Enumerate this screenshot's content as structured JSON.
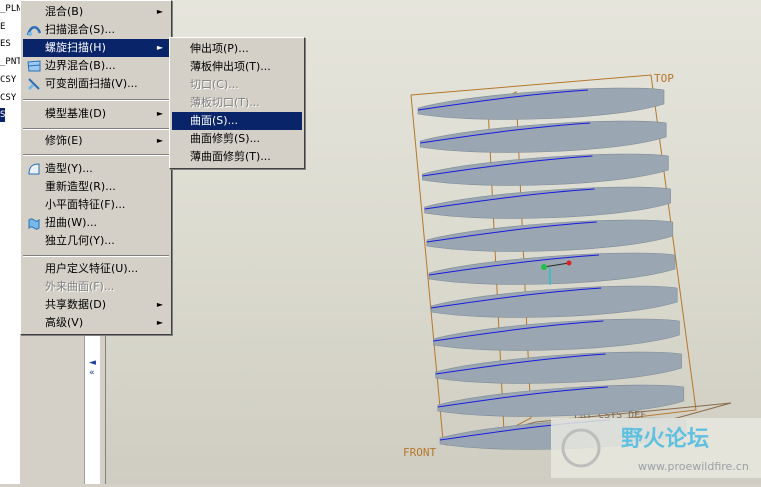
{
  "tree": {
    "items": [
      {
        "text": "_PLN",
        "selected": false
      },
      {
        "text": "E",
        "selected": false
      },
      {
        "text": "ES",
        "selected": false
      },
      {
        "text": "_PNT",
        "selected": false
      },
      {
        "text": "CSY",
        "selected": false
      },
      {
        "text": "CSY",
        "selected": false
      },
      {
        "text": "S",
        "selected": true
      }
    ]
  },
  "menu": {
    "items": [
      {
        "label": "混合(B)",
        "submenu": true,
        "icon": "none"
      },
      {
        "label": "扫描混合(S)...",
        "icon": "sweep-blend-icon"
      },
      {
        "label": "螺旋扫描(H)",
        "submenu": true,
        "highlighted": true,
        "icon": "none"
      },
      {
        "label": "边界混合(B)...",
        "icon": "boundary-blend-icon"
      },
      {
        "label": "可变剖面扫描(V)...",
        "icon": "variable-section-sweep-icon"
      },
      {
        "label": "模型基准(D)",
        "submenu": true,
        "icon": "none"
      },
      {
        "label": "修饰(E)",
        "submenu": true,
        "icon": "none"
      },
      {
        "label": "造型(Y)...",
        "icon": "style-icon"
      },
      {
        "label": "重新造型(R)...",
        "icon": "none"
      },
      {
        "label": "小平面特征(F)...",
        "icon": "none"
      },
      {
        "label": "扭曲(W)...",
        "icon": "warp-icon"
      },
      {
        "label": "独立几何(Y)...",
        "icon": "none"
      },
      {
        "label": "用户定义特征(U)...",
        "icon": "none"
      },
      {
        "label": "外来曲面(F)...",
        "disabled": true,
        "icon": "none"
      },
      {
        "label": "共享数据(D)",
        "submenu": true,
        "icon": "none"
      },
      {
        "label": "高级(V)",
        "submenu": true,
        "icon": "none"
      }
    ]
  },
  "submenu": {
    "items": [
      {
        "label": "伸出项(P)..."
      },
      {
        "label": "薄板伸出项(T)..."
      },
      {
        "label": "切口(C)...",
        "disabled": true
      },
      {
        "label": "薄板切口(T)...",
        "disabled": true
      },
      {
        "label": "曲面(S)...",
        "highlighted": true
      },
      {
        "label": "曲面修剪(S)..."
      },
      {
        "label": "薄曲面修剪(T)..."
      }
    ]
  },
  "viewport": {
    "datum_labels": {
      "top": "TOP",
      "front": "FRONT",
      "csys": "PRT_CSYS_DEF"
    },
    "watermark": {
      "title": "野火论坛",
      "url": "www.proewildfire.cn"
    }
  },
  "colors": {
    "menu_highlight": "#0a246a",
    "datum_plane": "#b5772c",
    "helix_curve": "#1a1adf",
    "surface": "#9aa7b2"
  }
}
